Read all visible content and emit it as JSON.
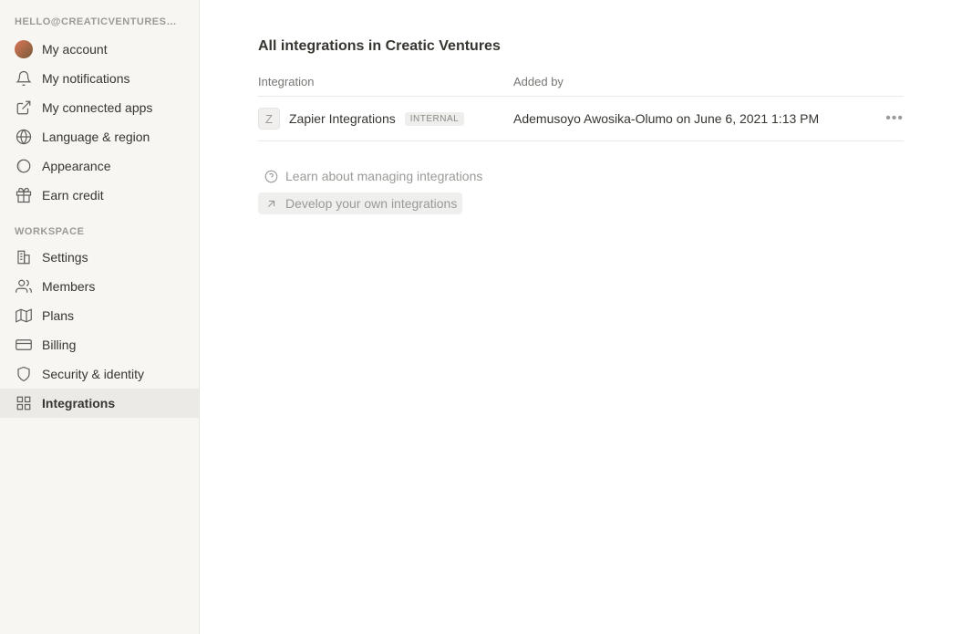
{
  "sidebar": {
    "header": "HELLO@CREATICVENTURES…",
    "account_section": [
      {
        "label": "My account"
      },
      {
        "label": "My notifications"
      },
      {
        "label": "My connected apps"
      },
      {
        "label": "Language & region"
      },
      {
        "label": "Appearance"
      },
      {
        "label": "Earn credit"
      }
    ],
    "workspace_label": "WORKSPACE",
    "workspace_section": [
      {
        "label": "Settings"
      },
      {
        "label": "Members"
      },
      {
        "label": "Plans"
      },
      {
        "label": "Billing"
      },
      {
        "label": "Security & identity"
      },
      {
        "label": "Integrations"
      }
    ]
  },
  "main": {
    "title": "All integrations in Creatic Ventures",
    "table": {
      "col_integration": "Integration",
      "col_added_by": "Added by",
      "rows": [
        {
          "icon_letter": "Z",
          "name": "Zapier Integrations",
          "badge": "INTERNAL",
          "added_by": "Ademusoyo Awosika-Olumo on June 6, 2021 1:13 PM"
        }
      ]
    },
    "help_links": {
      "learn": "Learn about managing integrations",
      "develop": "Develop your own integrations"
    }
  }
}
